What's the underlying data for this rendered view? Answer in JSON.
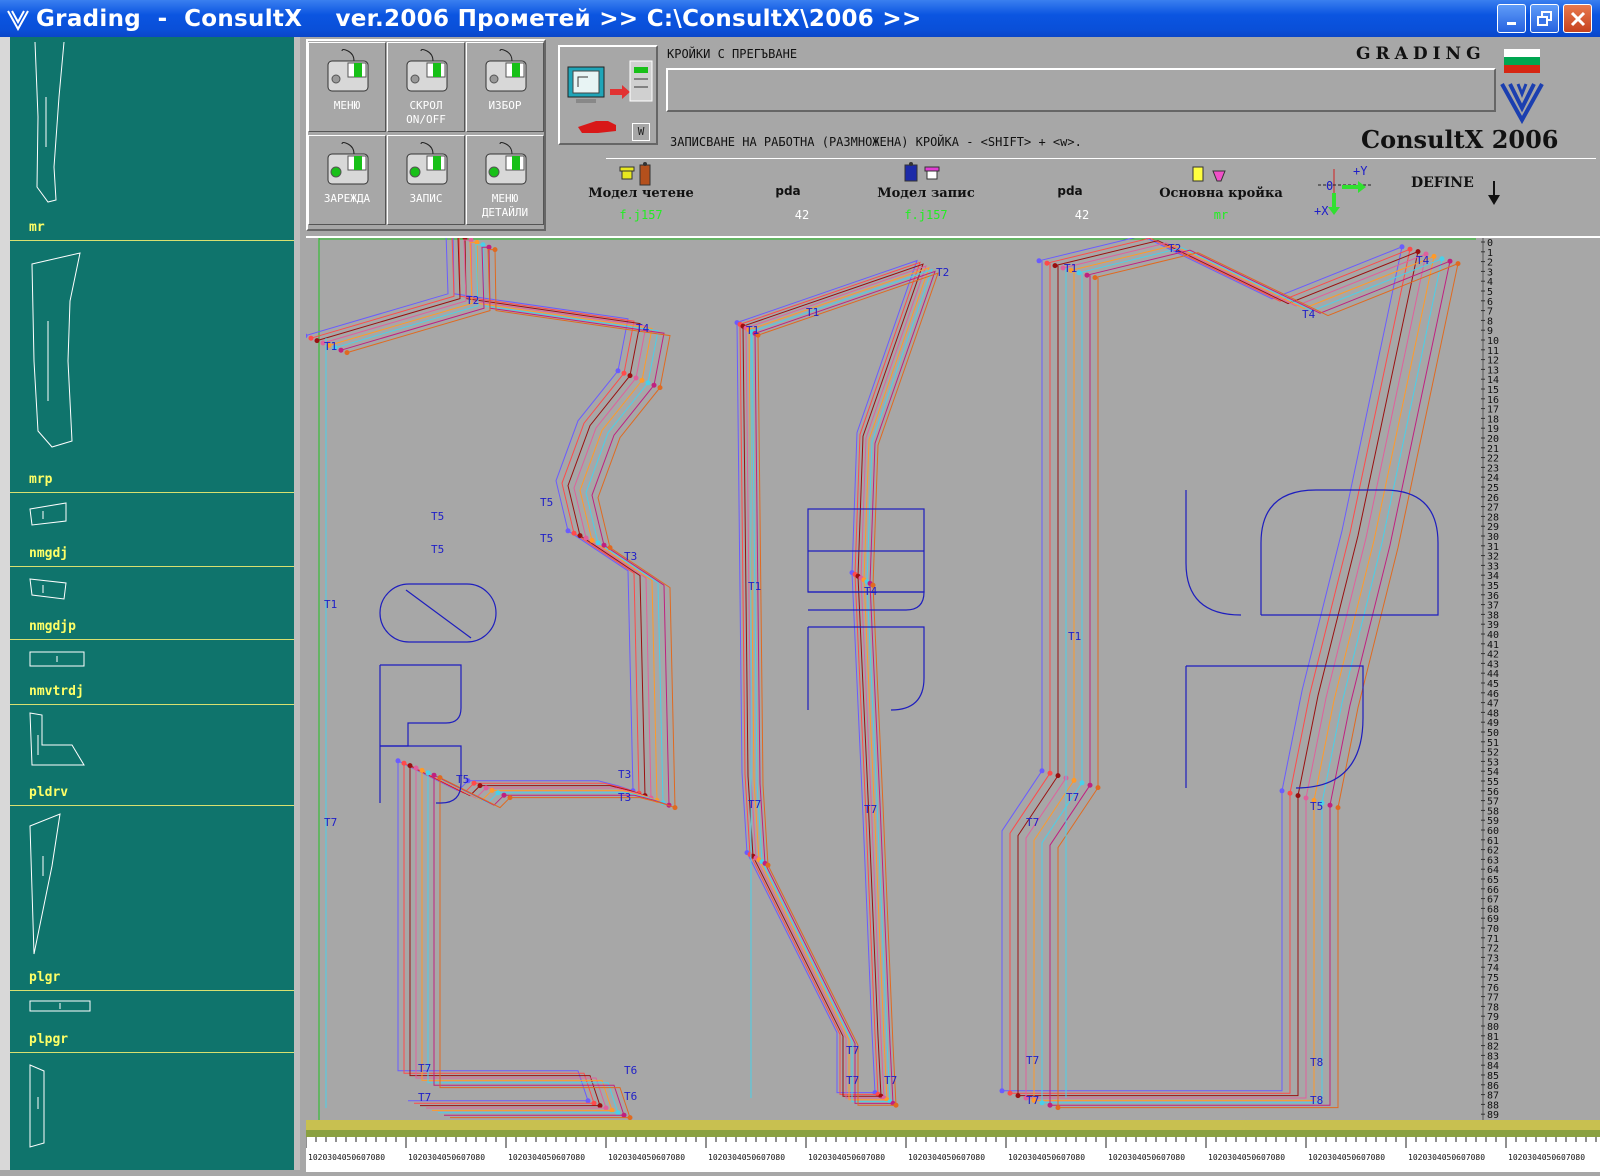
{
  "window": {
    "title": "Grading  -  ConsultX    ver.2006 Прометей >> C:\\ConsultX\\2006 >>"
  },
  "pieces": [
    {
      "name": "mr"
    },
    {
      "name": "mrp"
    },
    {
      "name": "nmgdj"
    },
    {
      "name": "nmgdjp"
    },
    {
      "name": "nmvtrdj"
    },
    {
      "name": "pldrv"
    },
    {
      "name": "plgr"
    },
    {
      "name": "plpgr"
    }
  ],
  "toolbar": {
    "buttons": [
      "МЕНЮ",
      "СКРОЛ ON/OFF",
      "ИЗБОР",
      "ЗАРЕЖДА",
      "ЗАПИС",
      "МЕНЮ\nДЕТАЙЛИ"
    ],
    "w_label": "W"
  },
  "header": {
    "subtitle": "КРОЙКИ С ПРЕГЪВАНЕ",
    "hint": "ЗАПИСВАНЕ НА РАБОТНА (РАЗМНОЖЕНА) КРОЙКА - <SHIFT> + <w>.",
    "grading_label": "GRADING",
    "brand": "ConsultX 2006",
    "define": "DEFINE"
  },
  "model": {
    "read_label": "Модел четене",
    "read_value": "f.j157",
    "read_size_label": "pda",
    "read_size": "42",
    "write_label": "Модел запис",
    "write_value": "f.j157",
    "write_size_label": "pda",
    "write_size": "42",
    "base_label": "Основна кройка",
    "base_value": "mr"
  },
  "axes": {
    "y_plus": "+Y",
    "x_plus": "+X",
    "origin": "0"
  },
  "colors": {
    "title_bar": "#0b55e1",
    "left_panel": "#0f746c",
    "piece_label": "#ffff66",
    "canvas": "#a7a7a7",
    "model_value": "#22ee22"
  }
}
